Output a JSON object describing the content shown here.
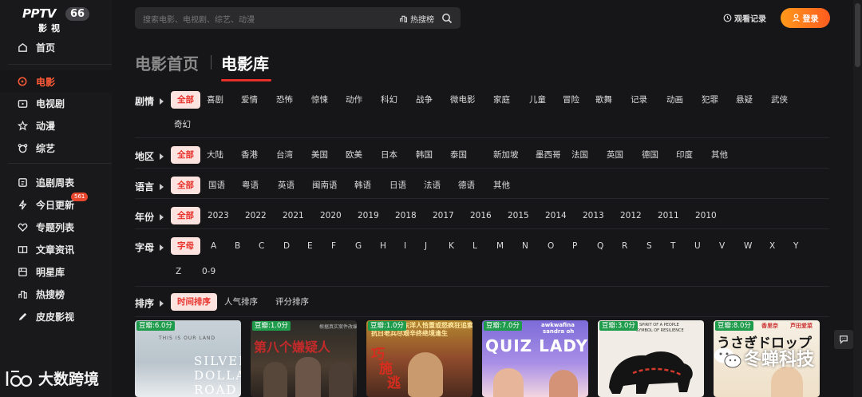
{
  "app": {
    "brand": "PPTV",
    "badge": "66",
    "sub": "影视"
  },
  "sidebar": {
    "items": [
      {
        "label": "首页",
        "icon": "home-icon"
      },
      {
        "label": "电影",
        "icon": "movie-icon",
        "active": true
      },
      {
        "label": "电视剧",
        "icon": "tv-icon"
      },
      {
        "label": "动漫",
        "icon": "anime-icon"
      },
      {
        "label": "综艺",
        "icon": "variety-icon"
      },
      {
        "label": "追剧周表",
        "icon": "calendar-icon"
      },
      {
        "label": "今日更新",
        "icon": "lightning-icon",
        "badge": "561"
      },
      {
        "label": "专题列表",
        "icon": "heart-icon"
      },
      {
        "label": "文章资讯",
        "icon": "book-icon"
      },
      {
        "label": "明星库",
        "icon": "star-library-icon"
      },
      {
        "label": "热搜榜",
        "icon": "hot-list-icon"
      },
      {
        "label": "皮皮影视",
        "icon": "pen-icon"
      }
    ]
  },
  "search": {
    "placeholder": "搜索电影、电视剧、综艺、动漫",
    "hot_label": "热搜榜"
  },
  "header": {
    "history_label": "观看记录",
    "login_label": "登录"
  },
  "tabs": {
    "home": "电影首页",
    "library": "电影库"
  },
  "filters": {
    "genre": {
      "label": "剧情",
      "options": [
        "全部",
        "喜剧",
        "爱情",
        "恐怖",
        "惊悚",
        "动作",
        "科幻",
        "战争",
        "微电影",
        "家庭",
        "儿童",
        "冒险",
        "歌舞",
        "记录",
        "动画",
        "犯罪",
        "悬疑",
        "武侠",
        "奇幻"
      ]
    },
    "region": {
      "label": "地区",
      "options": [
        "全部",
        "大陆",
        "香港",
        "台湾",
        "美国",
        "欧美",
        "日本",
        "韩国",
        "泰国",
        "新加坡",
        "墨西哥",
        "法国",
        "英国",
        "德国",
        "印度",
        "其他"
      ]
    },
    "language": {
      "label": "语言",
      "options": [
        "全部",
        "国语",
        "粤语",
        "英语",
        "闽南语",
        "韩语",
        "日语",
        "法语",
        "德语",
        "其他"
      ]
    },
    "year": {
      "label": "年份",
      "options": [
        "全部",
        "2023",
        "2022",
        "2021",
        "2020",
        "2019",
        "2018",
        "2017",
        "2016",
        "2015",
        "2014",
        "2013",
        "2012",
        "2011",
        "2010"
      ]
    },
    "letter": {
      "label": "字母",
      "options": [
        "字母",
        "A",
        "B",
        "C",
        "D",
        "E",
        "F",
        "G",
        "H",
        "I",
        "J",
        "K",
        "L",
        "M",
        "N",
        "O",
        "P",
        "Q",
        "R",
        "S",
        "T",
        "U",
        "V",
        "W",
        "X",
        "Y",
        "Z",
        "0-9"
      ]
    },
    "sort": {
      "label": "排序",
      "options": [
        "时间排序",
        "人气排序",
        "评分排序"
      ]
    }
  },
  "posters": [
    {
      "score": "豆瓣:6.0分",
      "texts": [
        "THIS IS OUR LAND",
        "SILVER",
        "DOLLAR",
        "ROAD"
      ]
    },
    {
      "score": "豆瓣:1.0分",
      "texts": [
        "第八个嫌疑人",
        "根据真实案件改编"
      ]
    },
    {
      "score": "豆瓣:1.0分",
      "texts": [
        "东洋人恰重或怒疯狂追索",
        "抗日老兵尽艰辛终绝境逢生",
        "巧",
        "施",
        "逃"
      ]
    },
    {
      "score": "豆瓣:7.0分",
      "texts": [
        "QUIZ LADY",
        "awkwafina",
        "sandra oh"
      ]
    },
    {
      "score": "豆瓣:3.0分",
      "texts": [
        "SPIRIT OF A PEOPLE",
        "SYMBOL OF RESILIENCE"
      ]
    },
    {
      "score": "豆瓣:8.0分",
      "texts": [
        "うさぎドロップ",
        "香里奈",
        "芦田爱菜"
      ]
    }
  ],
  "watermarks": {
    "left": "大数跨境",
    "right": "冬蝉科技"
  },
  "colors": {
    "accent": "#e8302a",
    "login_gradient_start": "#ff9a1a",
    "login_gradient_end": "#ff5b1f",
    "chip_selected_bg": "#fde3df",
    "score_badge": "#1f9b4c"
  }
}
